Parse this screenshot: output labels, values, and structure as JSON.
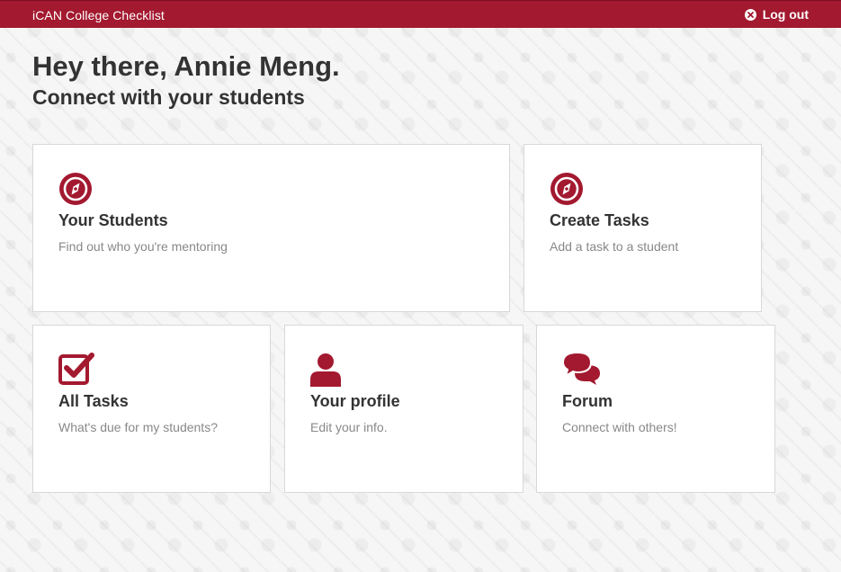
{
  "header": {
    "app_title": "iCAN College Checklist",
    "logout_label": "Log out"
  },
  "greeting": {
    "title": "Hey there, Annie Meng.",
    "subtitle": "Connect with your students"
  },
  "cards": {
    "students": {
      "title": "Your Students",
      "desc": "Find out who you're mentoring",
      "icon": "compass-icon"
    },
    "create_tasks": {
      "title": "Create Tasks",
      "desc": "Add a task to a student",
      "icon": "compass-icon"
    },
    "all_tasks": {
      "title": "All Tasks",
      "desc": "What's due for my students?",
      "icon": "checkbox-icon"
    },
    "profile": {
      "title": "Your profile",
      "desc": "Edit your info.",
      "icon": "user-icon"
    },
    "forum": {
      "title": "Forum",
      "desc": "Connect with others!",
      "icon": "chat-bubbles-icon"
    }
  },
  "colors": {
    "brand": "#a3192f",
    "text": "#333333",
    "muted": "#888888"
  }
}
